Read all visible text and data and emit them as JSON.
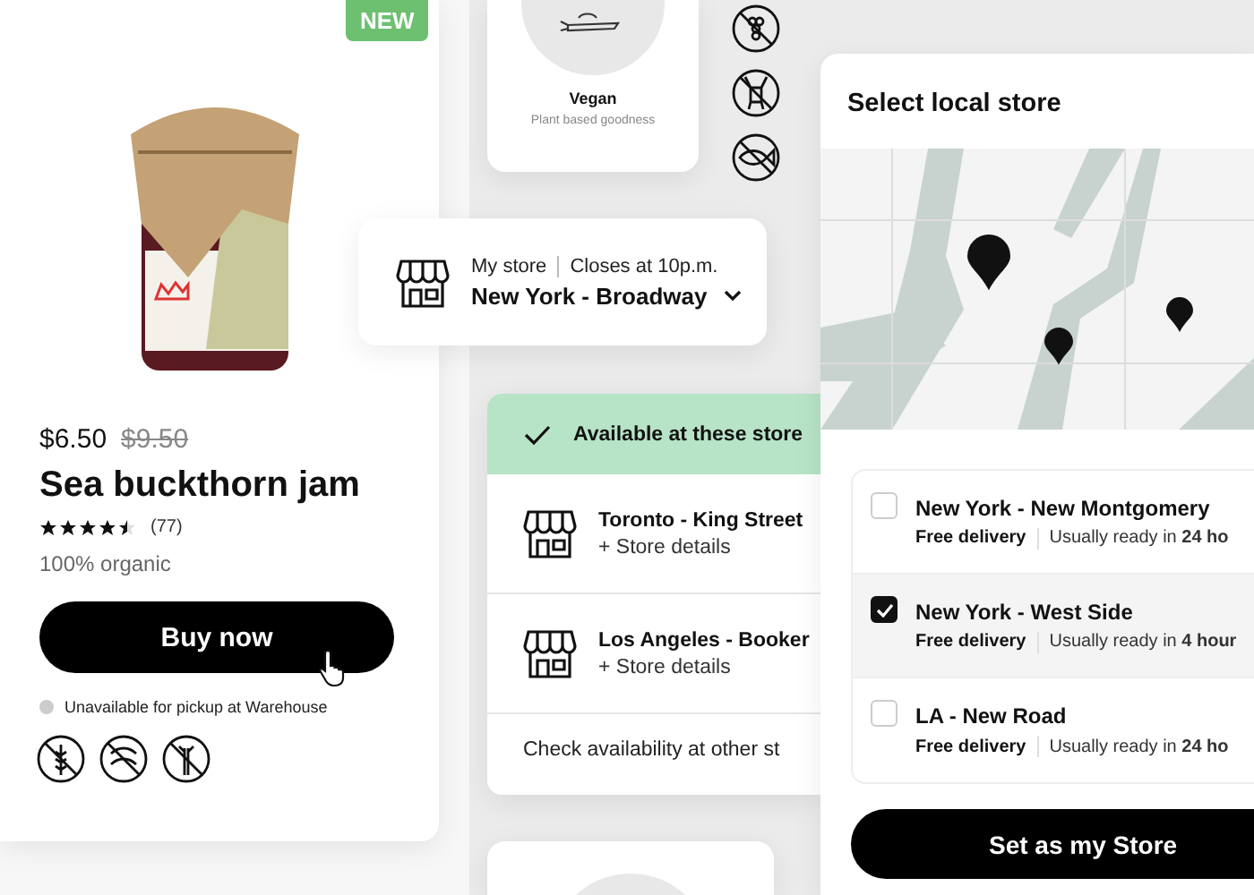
{
  "product_card": {
    "badge": "NEW",
    "price": "$6.50",
    "old_price": "$9.50",
    "title": "Sea buckthorn jam",
    "stars": 4.5,
    "rating_count": "(77)",
    "subtitle": "100% organic",
    "buy_button": "Buy now",
    "pickup_status": "Unavailable for pickup at Warehouse"
  },
  "category_card": {
    "title": "Vegan",
    "subtitle": "Plant based goodness"
  },
  "my_store": {
    "label": "My store",
    "hours": "Closes at 10p.m.",
    "store": "New York - Broadway"
  },
  "availability": {
    "header": "Available at these store",
    "stores": [
      {
        "name": "Toronto - King Street",
        "link": "+ Store details"
      },
      {
        "name": "Los Angeles - Booker",
        "link": "+ Store details"
      }
    ],
    "footer": "Check availability at other st"
  },
  "store_picker": {
    "title": "Select local store",
    "stores": [
      {
        "name": "New York - New Montgomery",
        "delivery": "Free delivery",
        "ready": "Usually ready in **24 ho**",
        "selected": false
      },
      {
        "name": "New York - West Side",
        "delivery": "Free delivery",
        "ready": "Usually ready in **4 hour**",
        "selected": true
      },
      {
        "name": "LA - New Road",
        "delivery": "Free delivery",
        "ready": "Usually ready in **24 ho**",
        "selected": false
      }
    ],
    "button": "Set as my Store"
  }
}
